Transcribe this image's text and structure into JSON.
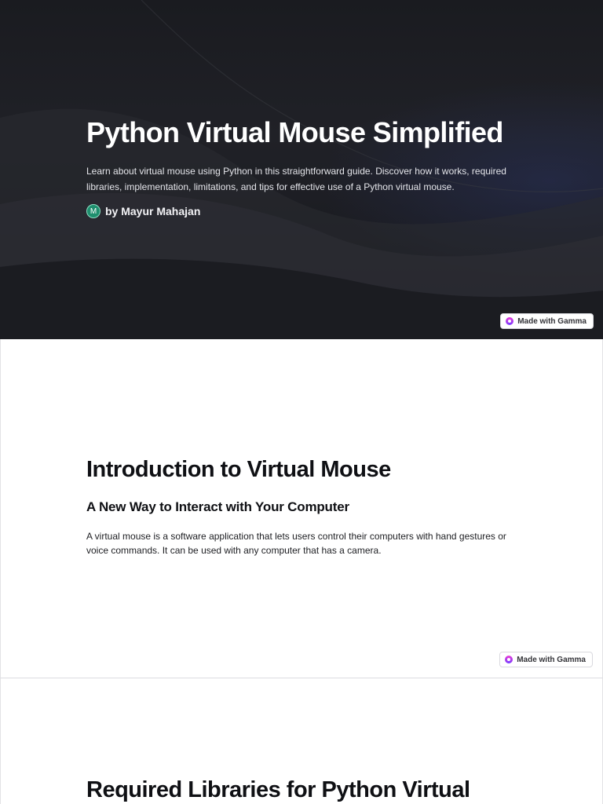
{
  "slides": {
    "hero": {
      "title": "Python Virtual Mouse Simplified",
      "description": "Learn about virtual mouse using Python in this straightforward guide. Discover how it works, required libraries, implementation, limitations, and tips for effective use of a Python virtual mouse.",
      "author_initial": "M",
      "byline": "by Mayur Mahajan",
      "badge": "Made with Gamma"
    },
    "intro": {
      "title": "Introduction to Virtual Mouse",
      "subtitle": "A New Way to Interact with Your Computer",
      "body": "A virtual mouse is a software application that lets users control their computers with hand gestures or voice commands. It can be used with any computer that has a camera.",
      "badge": "Made with Gamma"
    },
    "libraries": {
      "title": "Required Libraries for Python Virtual"
    }
  },
  "colors": {
    "hero_background": "#1c1d22",
    "accent_avatar": "#1f8f6e",
    "gamma_icon": "#c53ae6"
  },
  "icons": {
    "badge_icon": "gamma-logo-icon",
    "avatar": "author-avatar"
  }
}
